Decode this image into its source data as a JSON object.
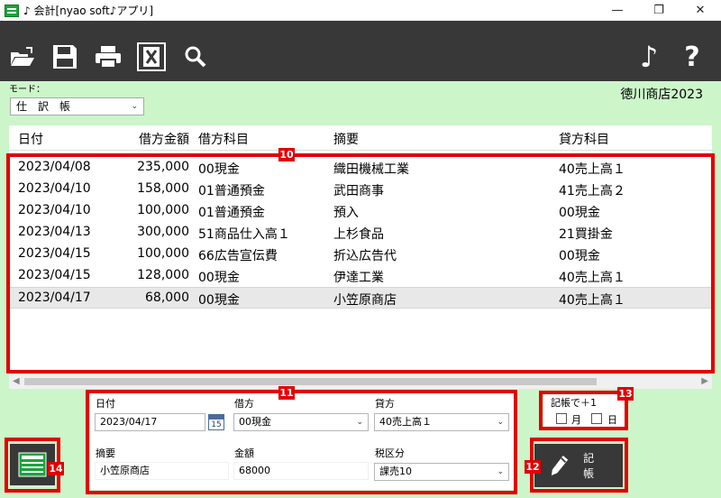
{
  "window": {
    "title": "♪ 会計[nyao soft♪アプリ]",
    "minimize": "—",
    "maximize": "❐",
    "close": "✕"
  },
  "toolbar": {
    "icons": [
      "open-folder-icon",
      "save-icon",
      "print-icon",
      "excel-icon",
      "search-icon",
      "music-note-icon",
      "help-icon"
    ],
    "music_label": "♪",
    "help_label": "?"
  },
  "mode": {
    "label": "モード：",
    "selected": "仕　訳　帳"
  },
  "shop_name": "徳川商店2023",
  "journal": {
    "headers": {
      "date": "日付",
      "amount": "借方金額",
      "debit": "借方科目",
      "memo": "摘要",
      "credit": "貸方科目"
    },
    "rows": [
      {
        "date": "2023/04/08",
        "amount": "235,000",
        "debit": "00現金",
        "memo": "織田機械工業",
        "credit": "40売上高１"
      },
      {
        "date": "2023/04/10",
        "amount": "158,000",
        "debit": "01普通預金",
        "memo": "武田商事",
        "credit": "41売上高２"
      },
      {
        "date": "2023/04/10",
        "amount": "100,000",
        "debit": "01普通預金",
        "memo": "預入",
        "credit": "00現金"
      },
      {
        "date": "2023/04/13",
        "amount": "300,000",
        "debit": "51商品仕入高１",
        "memo": "上杉食品",
        "credit": "21買掛金"
      },
      {
        "date": "2023/04/15",
        "amount": "100,000",
        "debit": "66広告宣伝費",
        "memo": "折込広告代",
        "credit": "00現金"
      },
      {
        "date": "2023/04/15",
        "amount": "128,000",
        "debit": "00現金",
        "memo": "伊達工業",
        "credit": "40売上高１"
      },
      {
        "date": "2023/04/17",
        "amount": "68,000",
        "debit": "00現金",
        "memo": "小笠原商店",
        "credit": "40売上高１"
      }
    ],
    "selected_row_index": 6
  },
  "form": {
    "date_label": "日付",
    "date_value": "2023/04/17",
    "calendar_day": "15",
    "debit_label": "借方",
    "debit_value": "00現金",
    "credit_label": "貸方",
    "credit_value": "40売上高１",
    "memo_label": "摘要",
    "memo_value": "小笠原商店",
    "amount_label": "金額",
    "amount_value": "68000",
    "tax_label": "税区分",
    "tax_value": "課売10"
  },
  "plus_one": {
    "label": "記帳で＋1",
    "month_label": "月",
    "day_label": "日",
    "month_checked": false,
    "day_checked": false
  },
  "record_button": {
    "label": "記帳"
  },
  "callouts": {
    "table": "10",
    "form": "11",
    "record": "12",
    "plus_one": "13",
    "calc": "14"
  },
  "colors": {
    "background": "#ccf5c9",
    "toolbar": "#383838",
    "callout": "#e00000",
    "app_icon": "#1aa53a"
  }
}
